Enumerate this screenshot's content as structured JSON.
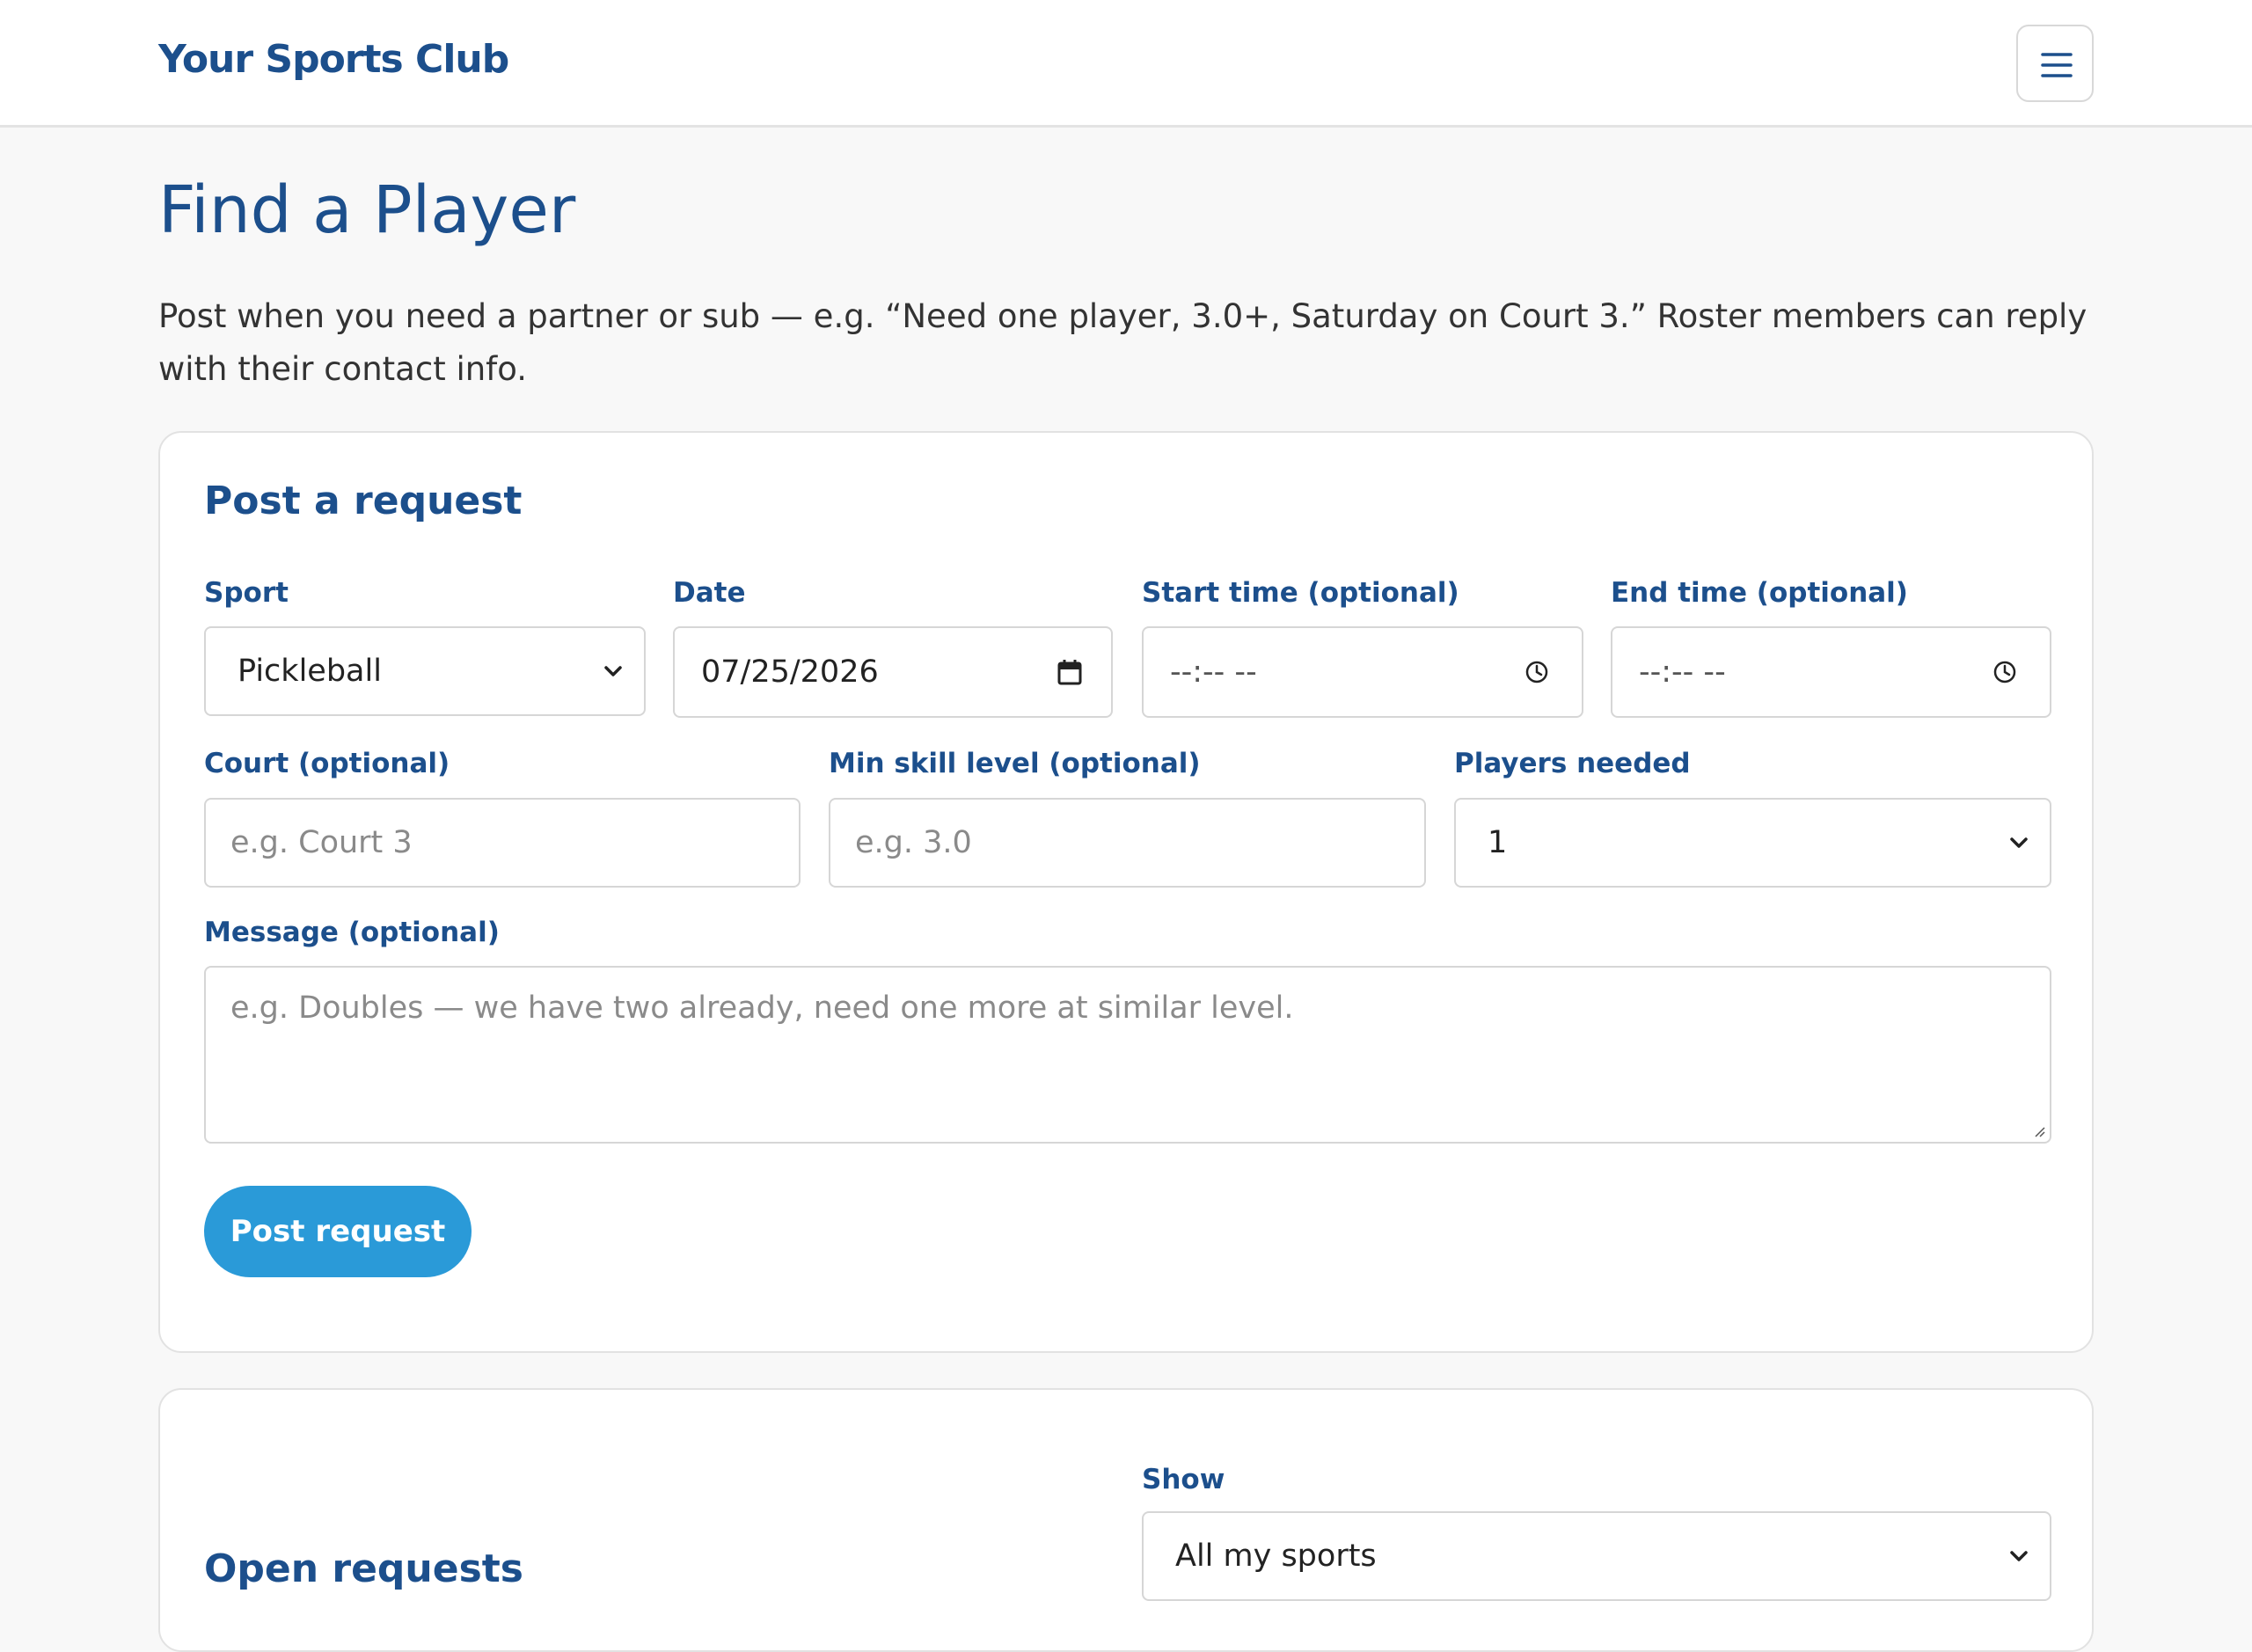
{
  "header": {
    "brand": "Your Sports Club",
    "menu_icon": "hamburger-menu-icon"
  },
  "page": {
    "title": "Find a Player",
    "intro": "Post when you need a partner or sub — e.g. “Need one player, 3.0+, Saturday on Court 3.” Roster members can reply with their contact info."
  },
  "post_form": {
    "title": "Post a request",
    "sport": {
      "label": "Sport",
      "value": "Pickleball"
    },
    "date": {
      "label": "Date",
      "value": "07/25/2026",
      "icon": "calendar-icon"
    },
    "start_time": {
      "label": "Start time (optional)",
      "value": "--:-- --",
      "icon": "clock-icon"
    },
    "end_time": {
      "label": "End time (optional)",
      "value": "--:-- --",
      "icon": "clock-icon"
    },
    "court": {
      "label": "Court (optional)",
      "placeholder": "e.g. Court 3"
    },
    "min_skill": {
      "label": "Min skill level (optional)",
      "placeholder": "e.g. 3.0"
    },
    "players_needed": {
      "label": "Players needed",
      "value": "1"
    },
    "message": {
      "label": "Message (optional)",
      "placeholder": "e.g. Doubles — we have two already, need one more at similar level."
    },
    "submit_label": "Post request"
  },
  "open_requests": {
    "title": "Open requests",
    "show": {
      "label": "Show",
      "value": "All my sports"
    }
  },
  "colors": {
    "brand": "#1c4f8c",
    "accent": "#2a9ad8",
    "background": "#f8f8f8"
  }
}
